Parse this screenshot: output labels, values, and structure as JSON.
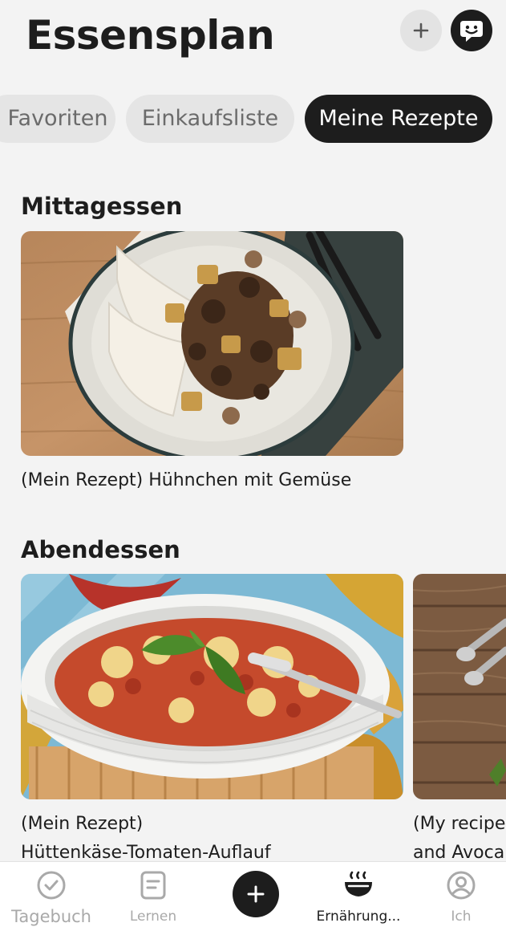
{
  "header": {
    "title": "Essensplan",
    "add_icon": "plus-icon",
    "chat_icon": "smiley-chat-icon"
  },
  "tabs": [
    {
      "label": "Favoriten",
      "active": false
    },
    {
      "label": "Einkaufsliste",
      "active": false
    },
    {
      "label": "Meine Rezepte",
      "active": true
    }
  ],
  "sections": [
    {
      "title": "Mittagessen",
      "cards": [
        {
          "caption_line1": "(Mein Rezept) Hühnchen mit Gemüse",
          "caption_line2": "",
          "image": "chicken-vegetables-tortilla-plate"
        }
      ]
    },
    {
      "title": "Abendessen",
      "cards": [
        {
          "caption_line1": "(Mein Rezept)",
          "caption_line2": "Hüttenkäse-Tomaten-Auflauf",
          "image": "cottage-cheese-tomato-casserole"
        },
        {
          "caption_line1": "(My recipe",
          "caption_line2": "and Avoca",
          "image": "wooden-table-spoons"
        }
      ]
    }
  ],
  "bottom_nav": [
    {
      "label": "Tagebuch",
      "icon": "check-circle-icon",
      "active": false
    },
    {
      "label": "Lernen",
      "icon": "document-icon",
      "active": false
    },
    {
      "label": "",
      "icon": "plus-icon",
      "active": false
    },
    {
      "label": "Ernährung...",
      "icon": "steaming-bowl-icon",
      "active": true
    },
    {
      "label": "Ich",
      "icon": "profile-icon",
      "active": false
    }
  ],
  "colors": {
    "background": "#f3f3f3",
    "dark": "#1d1d1d",
    "chip_inactive": "#e5e5e5",
    "nav_inactive": "#a9a9a9"
  }
}
